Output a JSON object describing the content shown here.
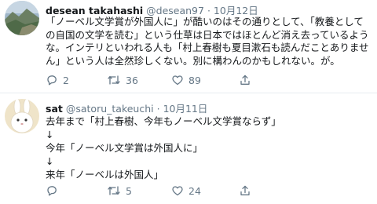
{
  "tweets": [
    {
      "name": "desean takahashi",
      "handle": "@desean97",
      "date": "10月12日",
      "lines": [
        "「ノーベル文学賞が外国人に」が酷いのはその通りとして、「教養として",
        "の自国の文学を読む」という仕草は日本ではほとんど消え去っているよう",
        "な。インテリといわれる人も「村上春樹も夏目漱石も読んだことありませ",
        "ん」という人は全然珍しくない。別に構わんのかもしれない。が。"
      ],
      "replies": "2",
      "retweets": "36",
      "likes": "89",
      "avatar_icon": "landscape-avatar-icon"
    },
    {
      "name": "sat",
      "handle": "@satoru_takeuchi",
      "date": "10月11日",
      "lines": [
        "去年まで「村上春樹、今年もノーベル文学賞ならず」",
        "↓",
        "今年「ノーベル文学賞は外国人に」",
        "↓",
        "来年「ノーベルは外国人」"
      ],
      "retweets": "5",
      "likes": "24",
      "avatar_icon": "rabbit-avatar-icon"
    }
  ],
  "colors": {
    "text": "#14171a",
    "muted": "#657786",
    "divider": "#e6ecf0"
  }
}
